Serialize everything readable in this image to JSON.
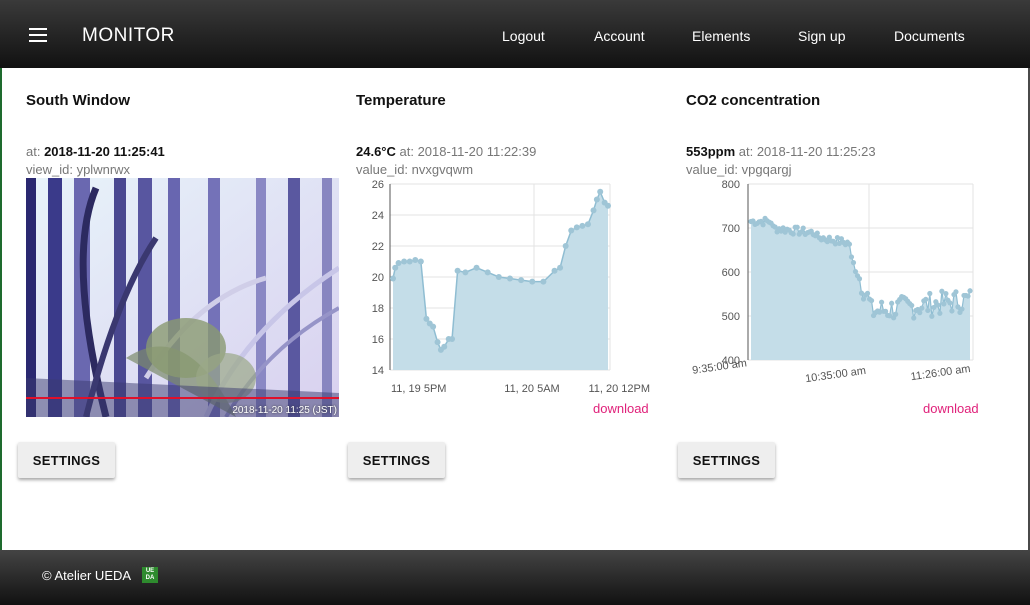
{
  "app": {
    "brand": "MONITOR"
  },
  "nav": {
    "links": [
      "Logout",
      "Account",
      "Elements",
      "Sign up",
      "Documents"
    ]
  },
  "cards": [
    {
      "title": "South Window",
      "at_prefix": "at: ",
      "at_value": "2018-11-20 11:25:41",
      "id_line": "view_id: yplwnrwx",
      "image_timestamp": "2018-11-20 11:25 (JST)",
      "settings": "SETTINGS"
    },
    {
      "title": "Temperature",
      "value": "24.6°C",
      "at_text": " at: 2018-11-20 11:22:39",
      "id_line": "value_id: nvxgvqwm",
      "download": "download",
      "settings": "SETTINGS"
    },
    {
      "title": "CO2 concentration",
      "value": "553ppm",
      "at_text": " at: 2018-11-20 11:25:23",
      "id_line": "value_id: vpgqargj",
      "download": "download",
      "settings": "SETTINGS"
    }
  ],
  "footer": {
    "copyright": "© Atelier UEDA",
    "logo_text": "UE DA"
  },
  "chart_data": [
    {
      "type": "area",
      "series": [
        {
          "color": "#9fc5d6",
          "x_hours": [
            0,
            0.2,
            0.5,
            1,
            1.5,
            2,
            2.5,
            3,
            3.3,
            3.6,
            4,
            4.3,
            4.6,
            5,
            5.3,
            5.8,
            6.5,
            7.5,
            8.5,
            9.5,
            10.5,
            11.5,
            12.5,
            13.5,
            14.5,
            15,
            15.5,
            16,
            16.5,
            17,
            17.5,
            18,
            18.3,
            18.6,
            19,
            19.3
          ],
          "values": [
            19.9,
            20.6,
            20.9,
            21,
            21,
            21.1,
            21,
            17.3,
            17,
            16.8,
            15.8,
            15.3,
            15.5,
            16,
            16,
            20.4,
            20.3,
            20.6,
            20.3,
            20,
            19.9,
            19.8,
            19.7,
            19.7,
            20.4,
            20.6,
            22,
            23,
            23.2,
            23.3,
            23.4,
            24.3,
            25,
            25.5,
            24.8,
            24.6
          ]
        }
      ],
      "x_ticks": [
        "11, 19 5PM",
        "11, 20 5AM",
        "11, 20 12PM"
      ],
      "y_ticks": [
        14,
        16,
        18,
        20,
        22,
        24,
        26
      ],
      "ylim": [
        14,
        26
      ]
    },
    {
      "type": "scatter-line",
      "series": [
        {
          "color": "#9fc5d6"
        }
      ],
      "x_ticks": [
        "9:35:00 am",
        "10:35:00 am",
        "11:26:00 am"
      ],
      "y_ticks": [
        400,
        500,
        600,
        700,
        800
      ],
      "ylim": [
        400,
        800
      ]
    }
  ]
}
